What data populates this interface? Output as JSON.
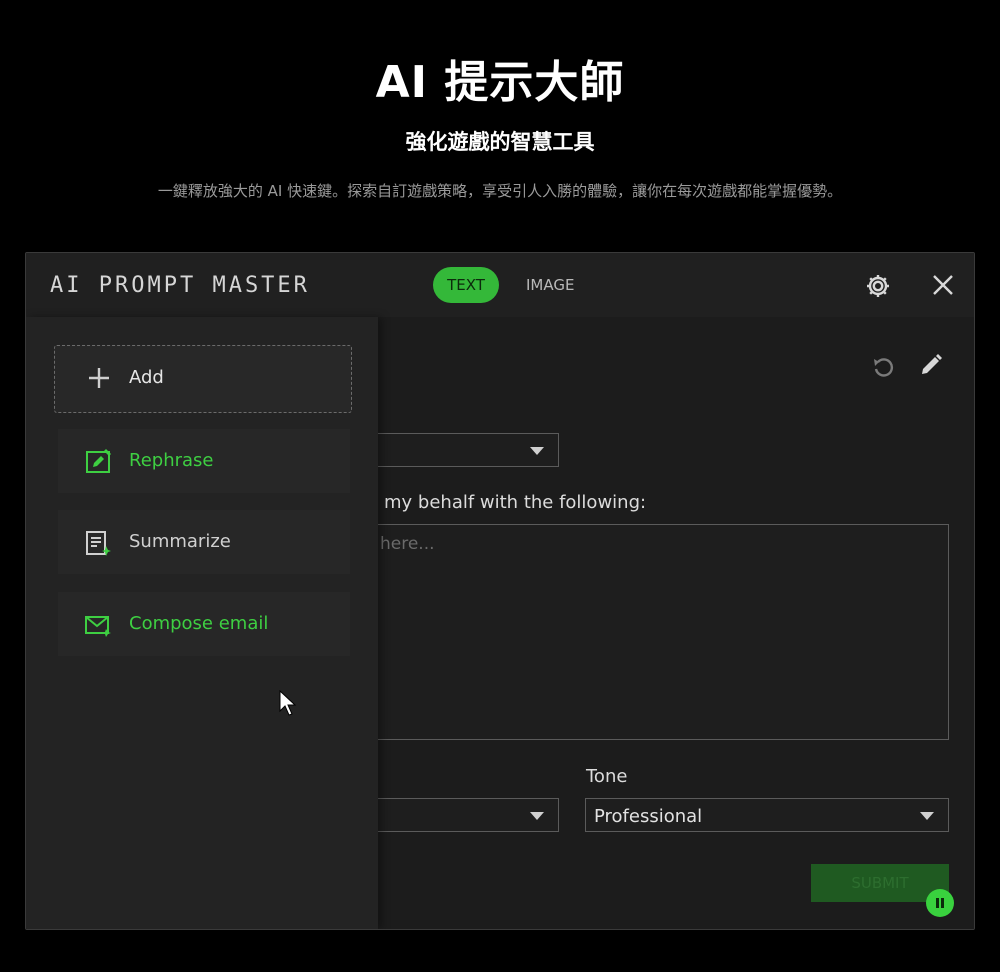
{
  "hero": {
    "title": "AI 提示大師",
    "subtitle": "強化遊戲的智慧工具",
    "description": "一鍵釋放強大的 AI 快速鍵。探索自訂遊戲策略，享受引人入勝的體驗，讓你在每次遊戲都能掌握優勢。"
  },
  "app": {
    "title": "AI PROMPT MASTER",
    "tabs": [
      {
        "label": "TEXT",
        "active": true
      },
      {
        "label": "IMAGE",
        "active": false
      }
    ]
  },
  "sidebar": {
    "add_label": "Add",
    "items": [
      {
        "label": "Rephrase",
        "icon": "rephrase-icon",
        "color": "#3ecf42"
      },
      {
        "label": "Summarize",
        "icon": "summarize-icon",
        "color": "#d0d0d0"
      },
      {
        "label": "Compose email",
        "icon": "mail-icon",
        "color": "#3ecf42"
      }
    ]
  },
  "form": {
    "instruction_label": "my behalf with the following:",
    "textarea_placeholder": "here...",
    "tone_label": "Tone",
    "tone_value": "Professional",
    "submit_label": "SUBMIT"
  },
  "colors": {
    "accent": "#39d13e",
    "background": "#000000",
    "panel": "#1c1c1c"
  }
}
